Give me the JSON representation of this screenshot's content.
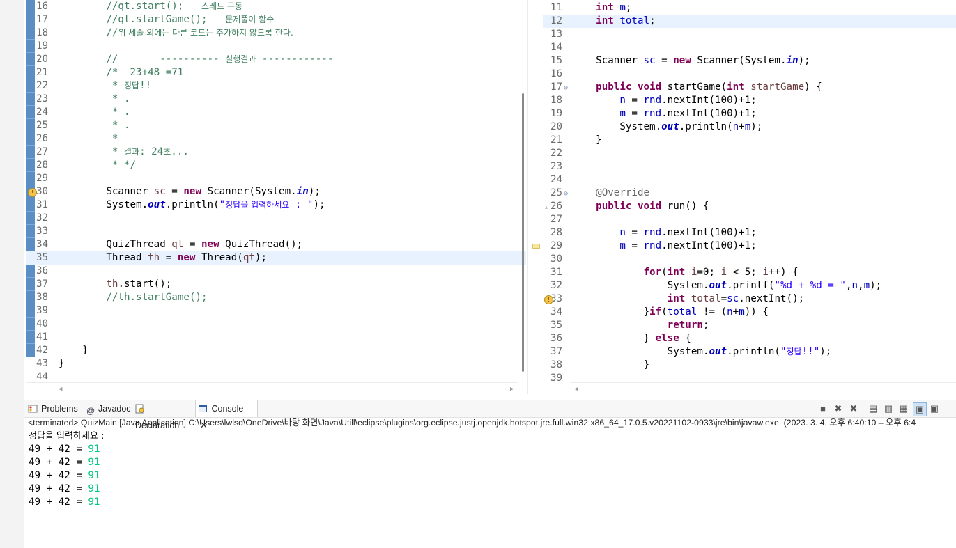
{
  "left_editor": {
    "lines": [
      {
        "n": "16",
        "html": "        <span class='cm'>//qt.start();   <span class='ko'>스레드 구동</span></span>"
      },
      {
        "n": "17",
        "html": "        <span class='cm'>//qt.startGame();   <span class='ko'>문제풀이 함수</span></span>"
      },
      {
        "n": "18",
        "html": "        <span class='cm'>//<span class='ko'>위 세줄 외에는 다른 코드는 추가하지 않도록 한다.</span></span>"
      },
      {
        "n": "19",
        "html": ""
      },
      {
        "n": "20",
        "html": "        <span class='cm'>//       ---------- <span class='ko'>실행결과</span> ------------</span>"
      },
      {
        "n": "21",
        "html": "        <span class='cm'>/*  23+48 =71</span>"
      },
      {
        "n": "22",
        "html": "<span class='cm'>         * <span class='ko'>정답</span>!!</span>"
      },
      {
        "n": "23",
        "html": "<span class='cm'>         * .</span>"
      },
      {
        "n": "24",
        "html": "<span class='cm'>         * .</span>"
      },
      {
        "n": "25",
        "html": "<span class='cm'>         * .</span>"
      },
      {
        "n": "26",
        "html": "<span class='cm'>         *</span>"
      },
      {
        "n": "27",
        "html": "<span class='cm'>         * <span class='ko'>결과</span>: 24<span class='ko'>초</span>...</span>"
      },
      {
        "n": "28",
        "html": "<span class='cm'>         * */</span>"
      },
      {
        "n": "29",
        "html": ""
      },
      {
        "n": "30",
        "html": "        Scanner <span class='vr'>sc</span> = <span class='kw'>new</span> Scanner(System.<span class='fd'>in</span>);"
      },
      {
        "n": "31",
        "html": "        System.<span class='fd'>out</span>.println(<span class='st'>\"<span class='ko'>정답을 입력하세요</span> : \"</span>);"
      },
      {
        "n": "32",
        "html": ""
      },
      {
        "n": "33",
        "html": ""
      },
      {
        "n": "34",
        "html": "        QuizThread <span class='vr'>qt</span> = <span class='kw'>new</span> QuizThread();"
      },
      {
        "n": "35",
        "html": "        Thread <span class='vr'>th</span> = <span class='kw'>new</span> Thread(<span class='vr'>qt</span>);"
      },
      {
        "n": "36",
        "html": ""
      },
      {
        "n": "37",
        "html": "        <span class='vr'>th</span>.start();"
      },
      {
        "n": "38",
        "html": "        <span class='cm'>//th.startGame();</span>"
      },
      {
        "n": "39",
        "html": ""
      },
      {
        "n": "40",
        "html": ""
      },
      {
        "n": "41",
        "html": ""
      },
      {
        "n": "42",
        "html": "    }"
      },
      {
        "n": "43",
        "html": "}"
      },
      {
        "n": "44",
        "html": ""
      }
    ]
  },
  "right_editor": {
    "lines": [
      {
        "n": "11",
        "html": "    <span class='kw'>int</span> <span class='fd' style='font-style:normal;font-weight:normal'>m</span>;"
      },
      {
        "n": "12",
        "html": "    <span class='kw'>int</span> <span class='fd' style='font-style:normal;font-weight:normal'>total</span>;"
      },
      {
        "n": "13",
        "html": ""
      },
      {
        "n": "14",
        "html": ""
      },
      {
        "n": "15",
        "html": "    Scanner <span class='fd' style='font-style:normal;font-weight:normal'>sc</span> = <span class='kw'>new</span> Scanner(System.<span class='fd'>in</span>);"
      },
      {
        "n": "16",
        "html": ""
      },
      {
        "n": "17",
        "html": "    <span class='kw'>public</span> <span class='kw'>void</span> startGame(<span class='kw'>int</span> <span class='vr'>startGame</span>) {"
      },
      {
        "n": "18",
        "html": "        <span class='fd' style='font-style:normal;font-weight:normal'>n</span> = <span class='fd' style='font-style:normal;font-weight:normal'>rnd</span>.nextInt(100)+1;"
      },
      {
        "n": "19",
        "html": "        <span class='fd' style='font-style:normal;font-weight:normal'>m</span> = <span class='fd' style='font-style:normal;font-weight:normal'>rnd</span>.nextInt(100)+1;"
      },
      {
        "n": "20",
        "html": "        System.<span class='fd'>out</span>.println(<span class='fd' style='font-style:normal;font-weight:normal'>n</span>+<span class='fd' style='font-style:normal;font-weight:normal'>m</span>);"
      },
      {
        "n": "21",
        "html": "    }"
      },
      {
        "n": "22",
        "html": ""
      },
      {
        "n": "23",
        "html": ""
      },
      {
        "n": "24",
        "html": ""
      },
      {
        "n": "25",
        "html": "    <span class='an'>@Override</span>"
      },
      {
        "n": "26",
        "html": "    <span class='kw'>public</span> <span class='kw'>void</span> run() {"
      },
      {
        "n": "27",
        "html": ""
      },
      {
        "n": "28",
        "html": "        <span class='fd' style='font-style:normal;font-weight:normal'>n</span> = <span class='fd' style='font-style:normal;font-weight:normal'>rnd</span>.nextInt(100)+1;"
      },
      {
        "n": "29",
        "html": "        <span class='fd' style='font-style:normal;font-weight:normal'>m</span> = <span class='fd' style='font-style:normal;font-weight:normal'>rnd</span>.nextInt(100)+1;"
      },
      {
        "n": "30",
        "html": ""
      },
      {
        "n": "31",
        "html": "            <span class='kw'>for</span>(<span class='kw'>int</span> <span class='vr'>i</span>=0; <span class='vr'>i</span> &lt; 5; <span class='vr'>i</span>++) {"
      },
      {
        "n": "32",
        "html": "                System.<span class='fd'>out</span>.printf(<span class='st'>\"%d + %d = \"</span>,<span class='fd' style='font-style:normal;font-weight:normal'>n</span>,<span class='fd' style='font-style:normal;font-weight:normal'>m</span>);"
      },
      {
        "n": "33",
        "html": "                <span class='kw'>int</span> <span class='vr'>total</span>=<span class='fd' style='font-style:normal;font-weight:normal'>sc</span>.nextInt();"
      },
      {
        "n": "34",
        "html": "            }<span class='kw'>if</span>(<span class='fd' style='font-style:normal;font-weight:normal'>total</span> != (<span class='fd' style='font-style:normal;font-weight:normal'>n</span>+<span class='fd' style='font-style:normal;font-weight:normal'>m</span>)) {"
      },
      {
        "n": "35",
        "html": "                <span class='kw'>return</span>;"
      },
      {
        "n": "36",
        "html": "            } <span class='kw'>else</span> {"
      },
      {
        "n": "37",
        "html": "                System.<span class='fd'>out</span>.println(<span class='st'>\"<span class='ko'>정답</span>!!\"</span>);"
      },
      {
        "n": "38",
        "html": "            }"
      },
      {
        "n": "39",
        "html": ""
      }
    ]
  },
  "console": {
    "tabs": [
      "Problems",
      "Javadoc",
      "Declaration",
      "Console"
    ],
    "terminated": "<terminated> QuizMain [Java Application] C:\\Users\\lwlsd\\OneDrive\\바탕 화면\\Java\\Utill\\eclipse\\plugins\\org.eclipse.justj.openjdk.hotspot.jre.full.win32.x86_64_17.0.5.v20221102-0933\\jre\\bin\\javaw.exe  (2023. 3. 4. 오후 6:40:10 – 오후 6:4",
    "prompt": "정답을 입력하세요 :",
    "output_prefix": "49 + 42 = ",
    "output_input": "91",
    "output_count": 5
  }
}
